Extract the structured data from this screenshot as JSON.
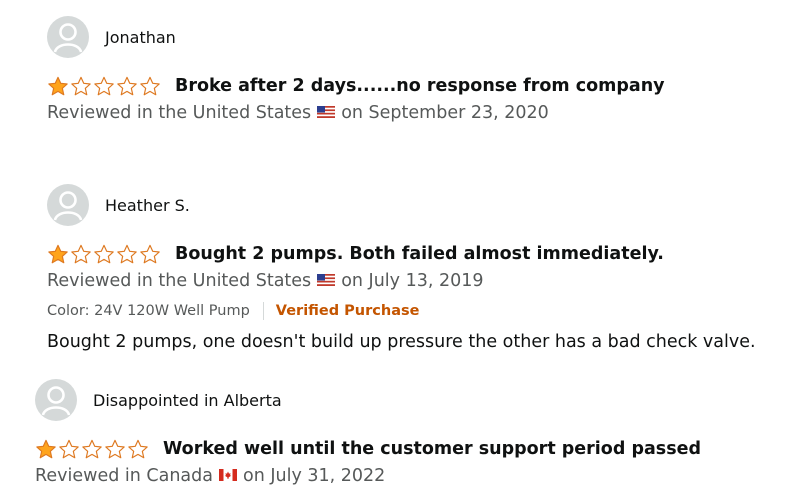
{
  "reviews": [
    {
      "reviewer": "Jonathan",
      "rating": 1,
      "rating_max": 5,
      "title": "Broke after 2 days......no response from company",
      "location_prefix": "Reviewed in the United States",
      "flag_icon": "us-flag-icon",
      "date": "on September 23, 2020"
    },
    {
      "reviewer": "Heather S.",
      "rating": 1,
      "rating_max": 5,
      "title": "Bought 2 pumps. Both failed almost immediately.",
      "location_prefix": "Reviewed in the United States",
      "flag_icon": "us-flag-icon",
      "date": "on July 13, 2019",
      "variant": "Color: 24V 120W Well Pump",
      "badge": "Verified Purchase",
      "body": "Bought 2 pumps, one doesn't build up pressure the other has a bad check valve."
    },
    {
      "reviewer": "Disappointed in Alberta",
      "rating": 1,
      "rating_max": 5,
      "title": "Worked well until the customer support period passed",
      "location_prefix": "Reviewed in Canada",
      "flag_icon": "canada-flag-icon",
      "date": "on July 31, 2022"
    }
  ],
  "colors": {
    "star_fill": "#ffa41c",
    "star_outline": "#de7921",
    "verified": "#c45500",
    "muted_text": "#565959",
    "avatar_bg": "#d5d9d9"
  }
}
